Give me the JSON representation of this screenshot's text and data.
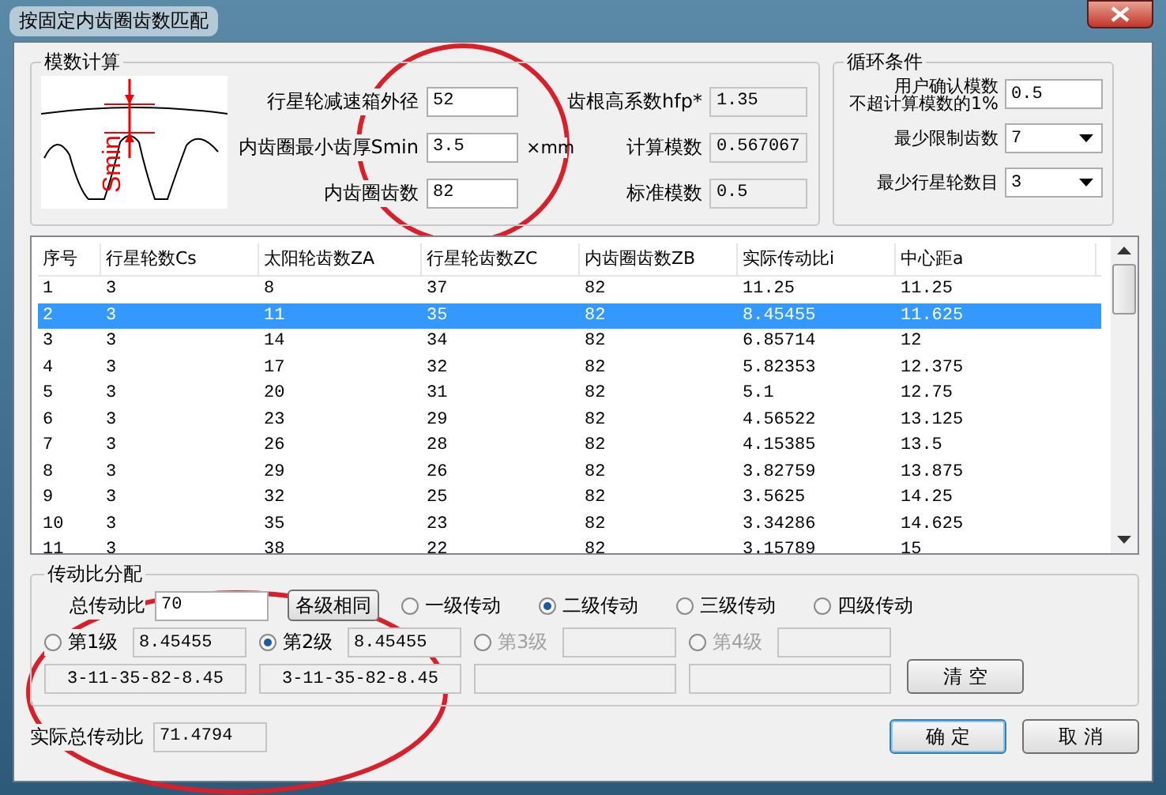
{
  "window": {
    "title": "按固定内齿圈齿数匹配"
  },
  "module_calc": {
    "title": "模数计算",
    "diagram_label": "Smin",
    "fields": [
      {
        "label": "行星轮减速箱外径",
        "value": "52"
      },
      {
        "label": "内齿圈最小齿厚Smin",
        "value": "3.5",
        "unit": "×mm"
      },
      {
        "label": "内齿圈齿数",
        "value": "82"
      }
    ],
    "results": [
      {
        "label": "齿根高系数hfp*",
        "value": "1.35"
      },
      {
        "label": "计算模数",
        "value": "0.567067"
      },
      {
        "label": "标准模数",
        "value": "0.5"
      }
    ]
  },
  "loop_conditions": {
    "title": "循环条件",
    "fields": [
      {
        "kind": "input",
        "label_lines": [
          "用户确认模数",
          "不超计算模数的1%"
        ],
        "value": "0.5"
      },
      {
        "kind": "dropdown",
        "label_lines": [
          "最少限制齿数"
        ],
        "value": "7"
      },
      {
        "kind": "dropdown",
        "label_lines": [
          "最少行星轮数目"
        ],
        "value": "3"
      }
    ]
  },
  "table": {
    "columns": [
      "序号",
      "行星轮数Cs",
      "太阳轮齿数ZA",
      "行星轮齿数ZC",
      "内齿圈齿数ZB",
      "实际传动比i",
      "中心距a"
    ],
    "rows": [
      {
        "cells": [
          "1",
          "3",
          "8",
          "37",
          "82",
          "11.25",
          "11.25"
        ],
        "selected": false
      },
      {
        "cells": [
          "2",
          "3",
          "11",
          "35",
          "82",
          "8.45455",
          "11.625"
        ],
        "selected": true
      },
      {
        "cells": [
          "3",
          "3",
          "14",
          "34",
          "82",
          "6.85714",
          "12"
        ],
        "selected": false
      },
      {
        "cells": [
          "4",
          "3",
          "17",
          "32",
          "82",
          "5.82353",
          "12.375"
        ],
        "selected": false
      },
      {
        "cells": [
          "5",
          "3",
          "20",
          "31",
          "82",
          "5.1",
          "12.75"
        ],
        "selected": false
      },
      {
        "cells": [
          "6",
          "3",
          "23",
          "29",
          "82",
          "4.56522",
          "13.125"
        ],
        "selected": false
      },
      {
        "cells": [
          "7",
          "3",
          "26",
          "28",
          "82",
          "4.15385",
          "13.5"
        ],
        "selected": false
      },
      {
        "cells": [
          "8",
          "3",
          "29",
          "26",
          "82",
          "3.82759",
          "13.875"
        ],
        "selected": false
      },
      {
        "cells": [
          "9",
          "3",
          "32",
          "25",
          "82",
          "3.5625",
          "14.25"
        ],
        "selected": false
      },
      {
        "cells": [
          "10",
          "3",
          "35",
          "23",
          "82",
          "3.34286",
          "14.625"
        ],
        "selected": false
      },
      {
        "cells": [
          "11",
          "3",
          "38",
          "22",
          "82",
          "3.15789",
          "15"
        ],
        "selected": false
      }
    ]
  },
  "ratio_allocation": {
    "title": "传动比分配",
    "total_label": "总传动比",
    "total_value": "70",
    "same_button": "各级相同",
    "stage_count_options": [
      {
        "label": "一级传动",
        "selected": false
      },
      {
        "label": "二级传动",
        "selected": true
      },
      {
        "label": "三级传动",
        "selected": false
      },
      {
        "label": "四级传动",
        "selected": false
      }
    ],
    "stages": [
      {
        "label": "第1级",
        "selected": false,
        "disabled": false,
        "ratio": "8.45455",
        "result": "3-11-35-82-8.45"
      },
      {
        "label": "第2级",
        "selected": true,
        "disabled": false,
        "ratio": "8.45455",
        "result": "3-11-35-82-8.45"
      },
      {
        "label": "第3级",
        "selected": false,
        "disabled": true
      },
      {
        "label": "第4级",
        "selected": false,
        "disabled": true
      }
    ],
    "clear_button": "清 空"
  },
  "actual_total": {
    "label": "实际总传动比",
    "value": "71.4794"
  },
  "buttons": [
    {
      "label": "确 定",
      "default": true
    },
    {
      "label": "取 消",
      "default": false
    }
  ]
}
